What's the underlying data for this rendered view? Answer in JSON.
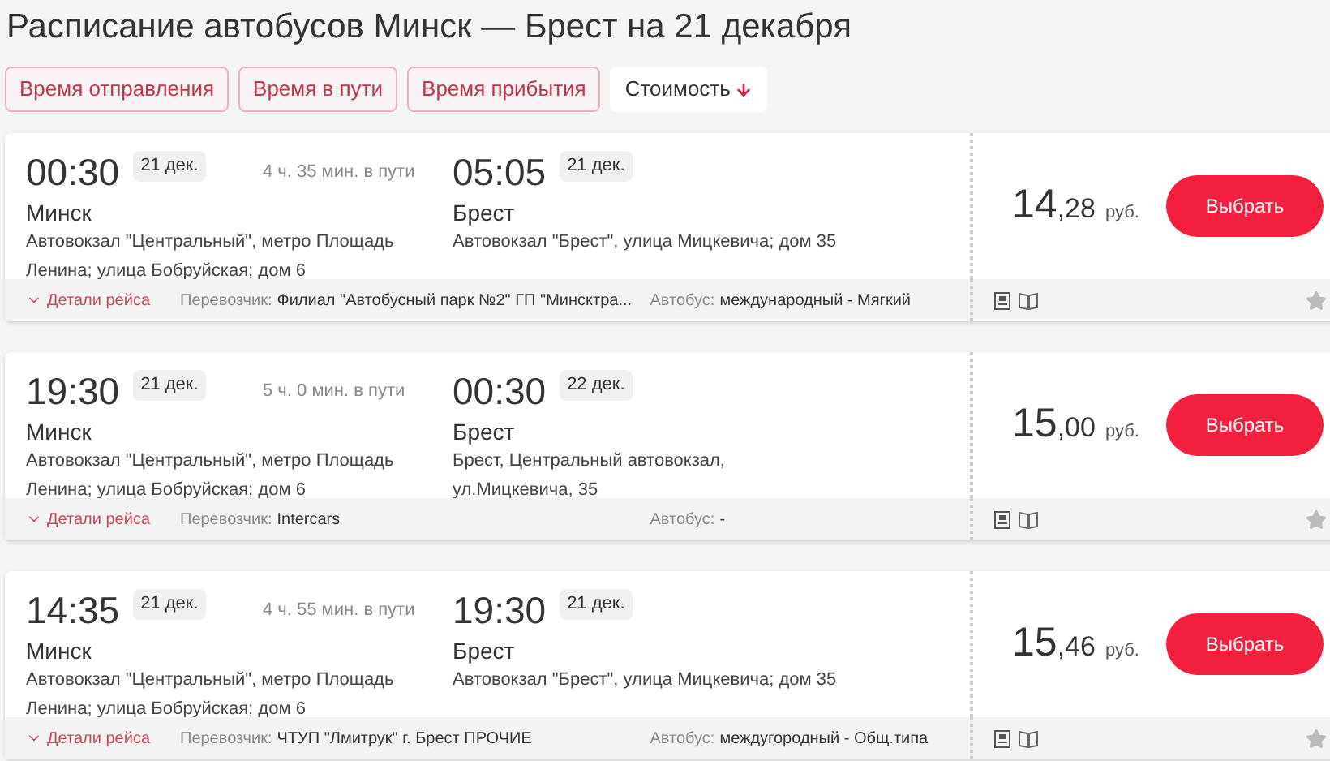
{
  "title": "Расписание автобусов Минск — Брест на 21 декабря",
  "sort_options": [
    {
      "label": "Время отправления",
      "selected": false
    },
    {
      "label": "Время в пути",
      "selected": false
    },
    {
      "label": "Время прибытия",
      "selected": false
    },
    {
      "label": "Стоимость",
      "selected": true
    }
  ],
  "trips": [
    {
      "departure": {
        "time": "00:30",
        "date": "21 дек.",
        "city": "Минск",
        "station": "Автовокзал \"Центральный\", метро Площадь Ленина; улица Бобруйская; дом 6"
      },
      "duration": "4 ч. 35 мин. в пути",
      "arrival": {
        "time": "05:05",
        "date": "21 дек.",
        "city": "Брест",
        "station": "Автовокзал \"Брест\", улица Мицкевича; дом 35"
      },
      "price_whole": "14",
      "price_fraction": ",28",
      "currency": "руб.",
      "select_button": "Выбрать",
      "details_link": "Детали рейса",
      "carrier_label": "Перевозчик:",
      "carrier": "Филиал \"Автобусный парк №2\" ГП \"Минсктра...",
      "bus_label": "Автобус:",
      "bus": "международный - Мягкий",
      "favorite": false
    },
    {
      "departure": {
        "time": "19:30",
        "date": "21 дек.",
        "city": "Минск",
        "station": "Автовокзал \"Центральный\", метро Площадь Ленина; улица Бобруйская; дом 6"
      },
      "duration": "5 ч. 0 мин. в пути",
      "arrival": {
        "time": "00:30",
        "date": "22 дек.",
        "city": "Брест",
        "station": "Брест, Центральный автовокзал, ул.Мицкевича, 35"
      },
      "price_whole": "15",
      "price_fraction": ",00",
      "currency": "руб.",
      "select_button": "Выбрать",
      "details_link": "Детали рейса",
      "carrier_label": "Перевозчик:",
      "carrier": "Intercars",
      "bus_label": "Автобус:",
      "bus": "-",
      "favorite": false
    },
    {
      "departure": {
        "time": "14:35",
        "date": "21 дек.",
        "city": "Минск",
        "station": "Автовокзал \"Центральный\", метро Площадь Ленина; улица Бобруйская; дом 6"
      },
      "duration": "4 ч. 55 мин. в пути",
      "arrival": {
        "time": "19:30",
        "date": "21 дек.",
        "city": "Брест",
        "station": "Автовокзал \"Брест\", улица Мицкевича; дом 35"
      },
      "price_whole": "15",
      "price_fraction": ",46",
      "currency": "руб.",
      "select_button": "Выбрать",
      "details_link": "Детали рейса",
      "carrier_label": "Перевозчик:",
      "carrier": "ЧТУП \"Лмитрук\" г. Брест ПРОЧИЕ",
      "bus_label": "Автобус:",
      "bus": "междугородный - Общ.типа",
      "favorite": false
    }
  ]
}
